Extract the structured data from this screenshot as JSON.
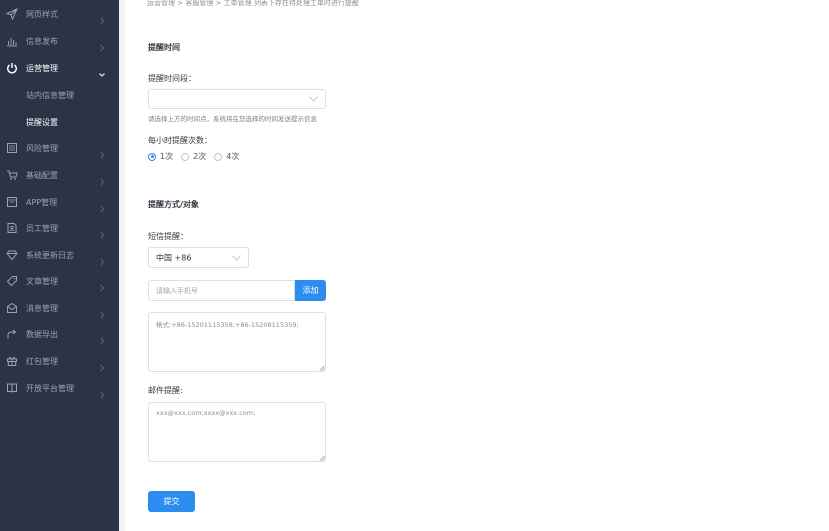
{
  "sidebar": {
    "items": [
      {
        "label": "网页样式",
        "icon": "send-icon"
      },
      {
        "label": "信息发布",
        "icon": "bar-chart-icon"
      },
      {
        "label": "运营管理",
        "icon": "power-icon",
        "expanded": true
      },
      {
        "label": "风险管理",
        "icon": "list-icon"
      },
      {
        "label": "基础配置",
        "icon": "cart-icon"
      },
      {
        "label": "APP管理",
        "icon": "app-window-icon"
      },
      {
        "label": "员工管理",
        "icon": "user-doc-icon"
      },
      {
        "label": "系统更新日志",
        "icon": "diamond-icon"
      },
      {
        "label": "文章管理",
        "icon": "tag-icon"
      },
      {
        "label": "消息管理",
        "icon": "mail-icon"
      },
      {
        "label": "数据导出",
        "icon": "share-icon"
      },
      {
        "label": "红包管理",
        "icon": "gift-icon"
      },
      {
        "label": "开放平台管理",
        "icon": "book-icon"
      }
    ],
    "sub_items": [
      {
        "label": "站内信息管理"
      },
      {
        "label": "提醒设置",
        "current": true
      }
    ]
  },
  "breadcrumb": "运营管理 > 客服管理 > 工单管理 列表下存在待处理工单时进行提醒",
  "reminder_time": {
    "section_title": "提醒时间",
    "period_label": "提醒时间段：",
    "period_value": "",
    "hint": "请选择上方的时间点，系统将在您选择的时间发送提示信息",
    "count_label": "每小时提醒次数：",
    "options": [
      "1次",
      "2次",
      "4次"
    ],
    "selected_option": "1次"
  },
  "reminder_method": {
    "section_title": "提醒方式/对象",
    "sms_label": "短信提醒：",
    "country_value": "中国 +86",
    "phone_placeholder": "请输入手机号",
    "add_label": "添加",
    "sms_textarea_placeholder": "格式:+86-15201115358;+86-15208115359;",
    "email_label": "邮件提醒:",
    "email_textarea_placeholder": "xxx@xxx.com;xxxx@xxx.com;"
  },
  "submit_label": "提交",
  "colors": {
    "sidebar_bg": "#2b3346",
    "accent": "#2d8cf0"
  }
}
